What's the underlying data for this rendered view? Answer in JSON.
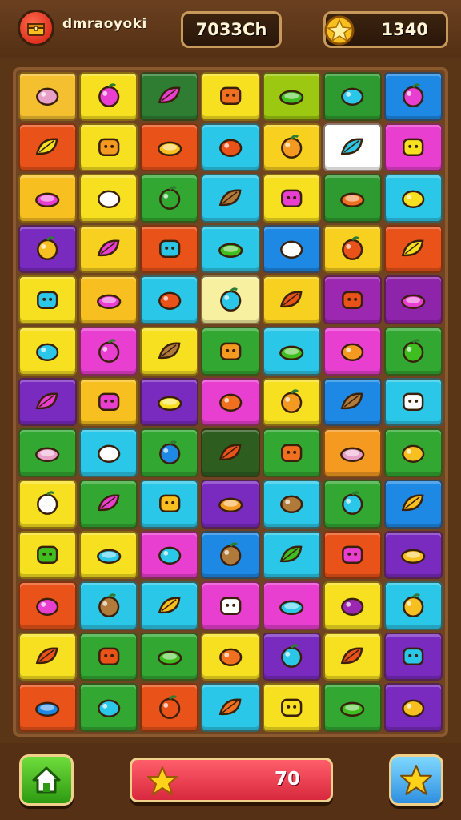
{
  "header": {
    "player_name": "dmraoyoki",
    "score": "7033Ch",
    "coins": "1340"
  },
  "footer": {
    "moves": "70"
  },
  "icons": {
    "avatar": "chest-icon",
    "coin": "star-coin-icon",
    "home": "home-icon",
    "progress_star": "star-icon",
    "bonus": "star-icon"
  },
  "colors": {
    "background": "#5a3516",
    "board": "#6e4422",
    "home_button": "#3fbf1f",
    "progress_bar": "#e8384b",
    "star_button": "#4aaef0"
  },
  "board": {
    "rows": 13,
    "cols": 7,
    "tiles": [
      [
        "#f5c030",
        "#f7e020",
        "#2e7d32",
        "#f7e020",
        "#9cc812",
        "#2e9b30",
        "#1e88e5"
      ],
      [
        "#e9531a",
        "#f7e020",
        "#e9531a",
        "#2bc7e8",
        "#f7d020",
        "#ffffff",
        "#e83fd0"
      ],
      [
        "#f7c020",
        "#f7e020",
        "#32a832",
        "#2bc7e8",
        "#f7e020",
        "#2e9b30",
        "#2bc7e8"
      ],
      [
        "#7a2bbf",
        "#f7d020",
        "#e9531a",
        "#2bc7e8",
        "#1e88e5",
        "#f7d020",
        "#e9531a"
      ],
      [
        "#f7e020",
        "#f7c020",
        "#2bc7e8",
        "#f7f0a0",
        "#f7d020",
        "#9c27b0",
        "#8e24aa"
      ],
      [
        "#f7e020",
        "#e83fd0",
        "#f7e020",
        "#32a832",
        "#2bc7e8",
        "#e83fd0",
        "#32a832"
      ],
      [
        "#7a2bbf",
        "#f7c020",
        "#7a2bbf",
        "#e83fd0",
        "#f7e020",
        "#1e88e5",
        "#2bc7e8"
      ],
      [
        "#32a832",
        "#2bc7e8",
        "#32a832",
        "#2e5d20",
        "#32a832",
        "#f59a20",
        "#32a832"
      ],
      [
        "#f7e020",
        "#32a832",
        "#2bc7e8",
        "#7a2bbf",
        "#2bc7e8",
        "#32a832",
        "#1e88e5"
      ],
      [
        "#f7e020",
        "#f7e020",
        "#e83fd0",
        "#1e88e5",
        "#2bc7e8",
        "#e9531a",
        "#7a2bbf"
      ],
      [
        "#e9531a",
        "#2bc7e8",
        "#2bc7e8",
        "#e83fd0",
        "#e83fd0",
        "#f7e020",
        "#2bc7e8"
      ],
      [
        "#f7e020",
        "#32a832",
        "#32a832",
        "#f7e020",
        "#7a2bbf",
        "#f7e020",
        "#7a2bbf"
      ],
      [
        "#e9531a",
        "#32a832",
        "#e9531a",
        "#2bc7e8",
        "#f7e020",
        "#32a832",
        "#7a2bbf"
      ]
    ],
    "items": [
      [
        "#e8a0c8",
        "#e83fd0",
        "#e83fd0",
        "#f07020",
        "#3fbf1f",
        "#2bc7e8",
        "#e83fd0"
      ],
      [
        "#f7e020",
        "#f59a20",
        "#f7c020",
        "#e9531a",
        "#f59a20",
        "#2bc7e8",
        "#f7e020"
      ],
      [
        "#e83fd0",
        "#ffffff",
        "#32a832",
        "#b07a3a",
        "#e83fd0",
        "#f07020",
        "#f7e020"
      ],
      [
        "#f7c020",
        "#e83fd0",
        "#2bc7e8",
        "#3fbf1f",
        "#ffffff",
        "#e9531a",
        "#f7e020"
      ],
      [
        "#2bc7e8",
        "#e83fd0",
        "#e9531a",
        "#2bc7e8",
        "#e9531a",
        "#e9531a",
        "#e83fd0"
      ],
      [
        "#2bc7e8",
        "#e83fd0",
        "#b07a3a",
        "#f59a20",
        "#3fbf1f",
        "#f59a20",
        "#3fbf1f"
      ],
      [
        "#e83fd0",
        "#e83fd0",
        "#f7e020",
        "#f07020",
        "#f59a20",
        "#b07a3a",
        "#ffffff"
      ],
      [
        "#e8a0c8",
        "#ffffff",
        "#1e88e5",
        "#e9531a",
        "#f07020",
        "#e8a0c8",
        "#f7c020"
      ],
      [
        "#ffffff",
        "#e83fd0",
        "#f7c020",
        "#f59a20",
        "#b07a3a",
        "#2bc7e8",
        "#f7c020"
      ],
      [
        "#3fbf1f",
        "#2bc7e8",
        "#2bc7e8",
        "#b07a3a",
        "#3fbf1f",
        "#e83fd0",
        "#f7c020"
      ],
      [
        "#e83fd0",
        "#b07a3a",
        "#f7c020",
        "#ffffff",
        "#2bc7e8",
        "#9c27b0",
        "#f7c020"
      ],
      [
        "#e9531a",
        "#e9531a",
        "#3fbf1f",
        "#f07020",
        "#2bc7e8",
        "#e9531a",
        "#2bc7e8"
      ],
      [
        "#1e88e5",
        "#2bc7e8",
        "#e9531a",
        "#f07020",
        "#f7e020",
        "#3fbf1f",
        "#f7c020"
      ]
    ]
  }
}
